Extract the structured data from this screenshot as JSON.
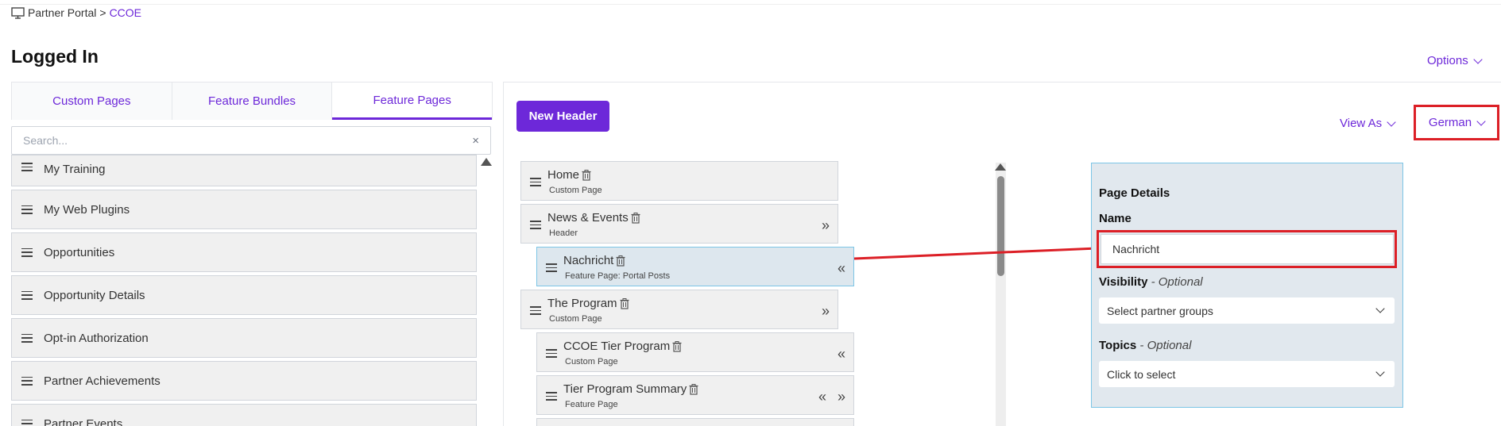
{
  "breadcrumb": {
    "root": "Partner Portal",
    "separator": ">",
    "current": "CCOE"
  },
  "page_title": "Logged In",
  "options_label": "Options",
  "tabs": [
    {
      "label": "Custom Pages",
      "active": false
    },
    {
      "label": "Feature Bundles",
      "active": false
    },
    {
      "label": "Feature Pages",
      "active": true
    }
  ],
  "search": {
    "placeholder": "Search...",
    "clear_icon": "×"
  },
  "feature_pages": [
    "My Training",
    "My Web Plugins",
    "Opportunities",
    "Opportunity Details",
    "Opt-in Authorization",
    "Partner Achievements",
    "Partner Events"
  ],
  "toolbar": {
    "new_header_label": "New Header",
    "view_as_label": "View As",
    "language_label": "German"
  },
  "tree": [
    {
      "name": "Home",
      "type": "Custom Page",
      "indent": 0,
      "controls": []
    },
    {
      "name": "News & Events",
      "type": "Header",
      "indent": 0,
      "controls": [
        "»"
      ]
    },
    {
      "name": "Nachricht",
      "type": "Feature Page: Portal Posts",
      "indent": 1,
      "selected": true,
      "controls": [
        "«"
      ]
    },
    {
      "name": "The Program",
      "type": "Custom Page",
      "indent": 0,
      "controls": [
        "»"
      ]
    },
    {
      "name": "CCOE Tier Program",
      "type": "Custom Page",
      "indent": 1,
      "controls": [
        "«"
      ]
    },
    {
      "name": "Tier Program Summary",
      "type": "Feature Page",
      "indent": 1,
      "controls": [
        "«",
        "»"
      ]
    }
  ],
  "details": {
    "title": "Page Details",
    "name_label": "Name",
    "name_value": "Nachricht",
    "visibility_label": "Visibility",
    "visibility_optional": "- Optional",
    "visibility_placeholder": "Select partner groups",
    "topics_label": "Topics",
    "topics_optional": "- Optional",
    "topics_placeholder": "Click to select"
  },
  "colors": {
    "accent": "#6d28d9",
    "highlight": "#dc1f26",
    "selected_border": "#7cc5e6"
  }
}
